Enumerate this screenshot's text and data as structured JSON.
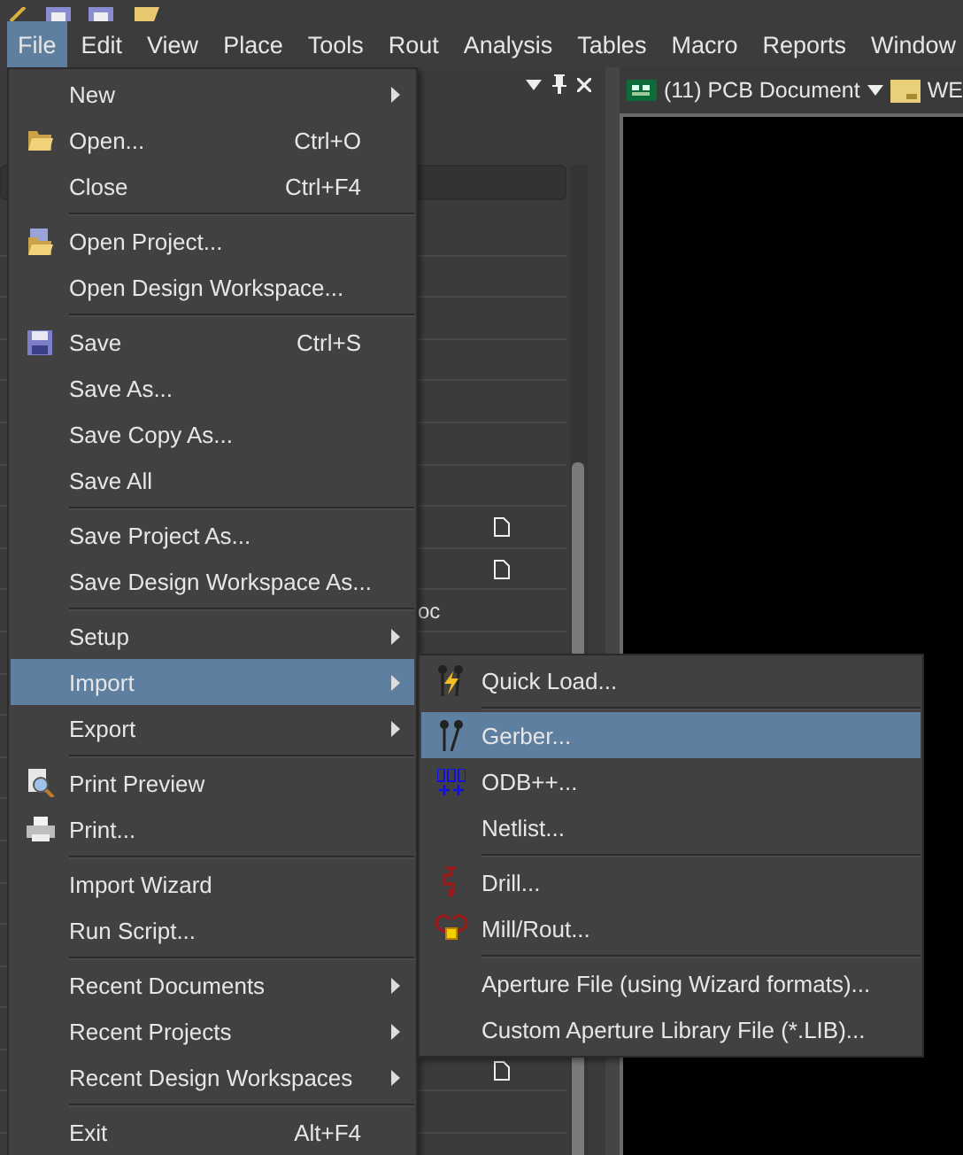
{
  "menubar": [
    {
      "label": "File",
      "selected": true
    },
    {
      "label": "Edit",
      "selected": false
    },
    {
      "label": "View",
      "selected": false
    },
    {
      "label": "Place",
      "selected": false
    },
    {
      "label": "Tools",
      "selected": false
    },
    {
      "label": "Rout",
      "selected": false
    },
    {
      "label": "Analysis",
      "selected": false
    },
    {
      "label": "Tables",
      "selected": false
    },
    {
      "label": "Macro",
      "selected": false
    },
    {
      "label": "Reports",
      "selected": false
    },
    {
      "label": "Window",
      "selected": false
    }
  ],
  "document_tab": {
    "label": "(11) PCB Document",
    "next_label": "WE"
  },
  "panel": {
    "fragment": "oc"
  },
  "file_menu": [
    {
      "kind": "item",
      "label": "New",
      "submenu": true,
      "selected": false
    },
    {
      "kind": "item",
      "label": "Open...",
      "shortcut": "Ctrl+O",
      "selected": false
    },
    {
      "kind": "item",
      "label": "Close",
      "shortcut": "Ctrl+F4",
      "selected": false
    },
    {
      "kind": "separator"
    },
    {
      "kind": "item",
      "label": "Open Project...",
      "selected": false
    },
    {
      "kind": "item",
      "label": "Open Design Workspace...",
      "selected": false
    },
    {
      "kind": "separator"
    },
    {
      "kind": "item",
      "label": "Save",
      "shortcut": "Ctrl+S",
      "selected": false
    },
    {
      "kind": "item",
      "label": "Save As...",
      "selected": false
    },
    {
      "kind": "item",
      "label": "Save Copy As...",
      "selected": false
    },
    {
      "kind": "item",
      "label": "Save All",
      "selected": false
    },
    {
      "kind": "separator"
    },
    {
      "kind": "item",
      "label": "Save Project As...",
      "selected": false
    },
    {
      "kind": "item",
      "label": "Save Design Workspace As...",
      "selected": false
    },
    {
      "kind": "separator"
    },
    {
      "kind": "item",
      "label": "Setup",
      "submenu": true,
      "selected": false
    },
    {
      "kind": "item",
      "label": "Import",
      "submenu": true,
      "selected": true
    },
    {
      "kind": "item",
      "label": "Export",
      "submenu": true,
      "selected": false
    },
    {
      "kind": "separator"
    },
    {
      "kind": "item",
      "label": "Print Preview",
      "selected": false
    },
    {
      "kind": "item",
      "label": "Print...",
      "selected": false
    },
    {
      "kind": "separator"
    },
    {
      "kind": "item",
      "label": "Import Wizard",
      "selected": false
    },
    {
      "kind": "item",
      "label": "Run Script...",
      "selected": false
    },
    {
      "kind": "separator"
    },
    {
      "kind": "item",
      "label": "Recent Documents",
      "submenu": true,
      "selected": false
    },
    {
      "kind": "item",
      "label": "Recent Projects",
      "submenu": true,
      "selected": false
    },
    {
      "kind": "item",
      "label": "Recent Design Workspaces",
      "submenu": true,
      "selected": false
    },
    {
      "kind": "separator"
    },
    {
      "kind": "item",
      "label": "Exit",
      "shortcut": "Alt+F4",
      "selected": false
    }
  ],
  "import_submenu": [
    {
      "kind": "item",
      "label": "Quick Load...",
      "selected": false
    },
    {
      "kind": "separator"
    },
    {
      "kind": "item",
      "label": "Gerber...",
      "selected": true
    },
    {
      "kind": "item",
      "label": "ODB++...",
      "selected": false
    },
    {
      "kind": "item",
      "label": "Netlist...",
      "selected": false
    },
    {
      "kind": "separator"
    },
    {
      "kind": "item",
      "label": "Drill...",
      "selected": false
    },
    {
      "kind": "item",
      "label": "Mill/Rout...",
      "selected": false
    },
    {
      "kind": "separator"
    },
    {
      "kind": "item",
      "label": "Aperture File (using Wizard formats)...",
      "selected": false
    },
    {
      "kind": "item",
      "label": "Custom Aperture Library File (*.LIB)...",
      "selected": false
    }
  ]
}
